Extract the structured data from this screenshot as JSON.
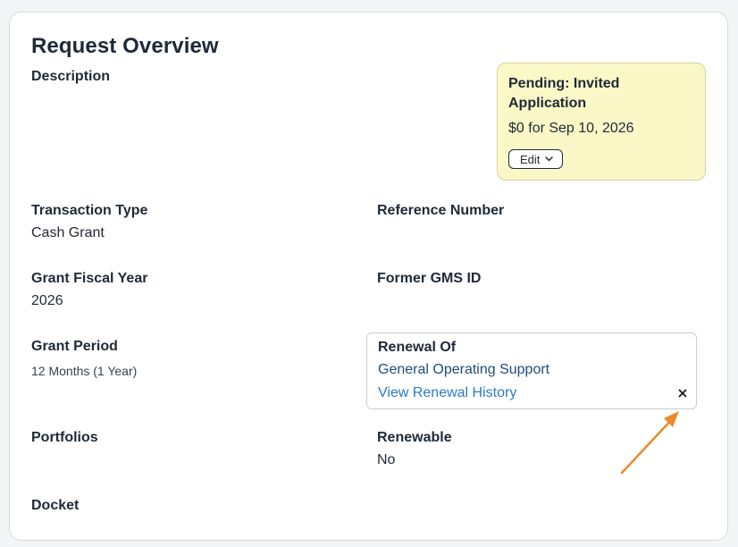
{
  "page": {
    "title": "Request Overview"
  },
  "fields": {
    "description_label": "Description",
    "transaction_type_label": "Transaction Type",
    "transaction_type_value": "Cash Grant",
    "reference_number_label": "Reference Number",
    "fiscal_year_label": "Grant Fiscal Year",
    "fiscal_year_value": "2026",
    "former_gms_label": "Former GMS ID",
    "grant_period_label": "Grant Period",
    "grant_period_value": "12 Months (1 Year)",
    "portfolios_label": "Portfolios",
    "renewable_label": "Renewable",
    "renewable_value": "No",
    "docket_label": "Docket"
  },
  "status": {
    "title": "Pending: Invited Application",
    "amount": "$0 for Sep 10, 2026",
    "edit_label": "Edit",
    "edit_icon": "chevron-down-icon"
  },
  "renewal": {
    "label": "Renewal Of",
    "link": "General Operating Support",
    "history_link": "View Renewal History",
    "close_icon": "close-icon"
  },
  "annotation": {
    "arrow_color": "#ea8a2a"
  }
}
